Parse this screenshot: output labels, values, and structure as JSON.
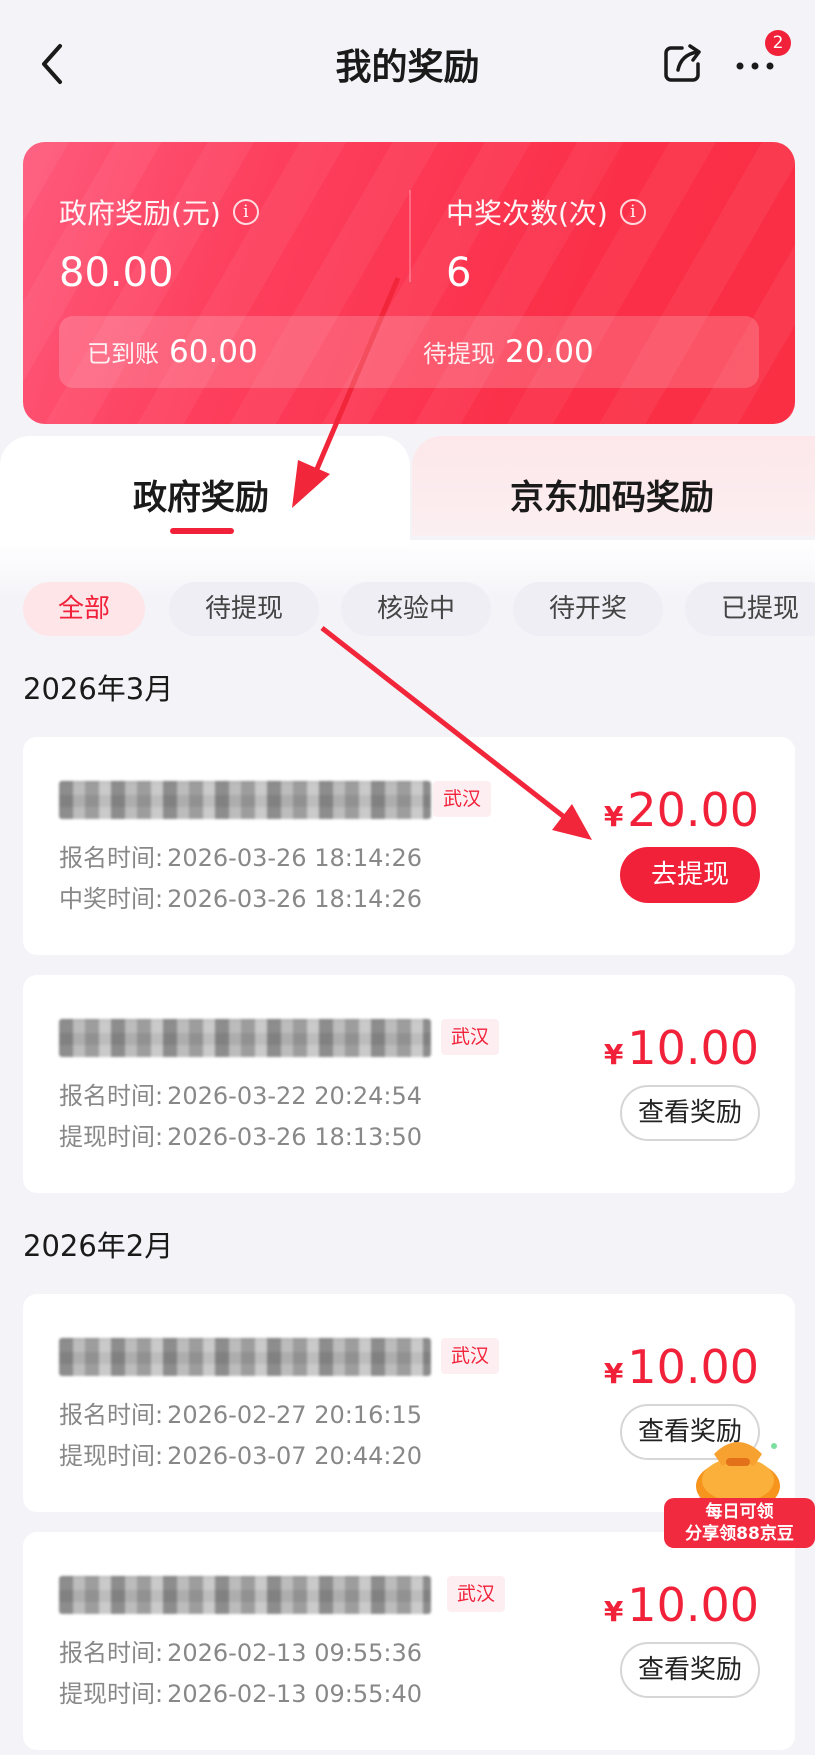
{
  "header": {
    "title": "我的奖励",
    "more_badge": "2",
    "icons": [
      "back-icon",
      "share-icon",
      "more-icon"
    ]
  },
  "summary": {
    "gov_reward_label": "政府奖励(元)",
    "gov_reward_value": "80.00",
    "win_count_label": "中奖次数(次)",
    "win_count_value": "6",
    "credited_label": "已到账",
    "credited_value": "60.00",
    "pending_label": "待提现",
    "pending_value": "20.00",
    "info_glyph": "i"
  },
  "tabs": [
    {
      "label": "政府奖励",
      "active": true
    },
    {
      "label": "京东加码奖励",
      "active": false
    }
  ],
  "filters": [
    {
      "label": "全部",
      "active": true
    },
    {
      "label": "待提现",
      "active": false
    },
    {
      "label": "核验中",
      "active": false
    },
    {
      "label": "待开奖",
      "active": false
    },
    {
      "label": "已提现",
      "active": false
    }
  ],
  "months": [
    {
      "title": "2026年3月",
      "items": [
        {
          "city": "武汉",
          "amount": "20.00",
          "currency": "¥",
          "line1_label": "报名时间:",
          "line1_value": "2026-03-26 18:14:26",
          "line2_label": "中奖时间:",
          "line2_value": "2026-03-26 18:14:26",
          "action": "去提现"
        },
        {
          "city": "武汉",
          "amount": "10.00",
          "currency": "¥",
          "line1_label": "报名时间:",
          "line1_value": "2026-03-22 20:24:54",
          "line2_label": "提现时间:",
          "line2_value": "2026-03-26 18:13:50",
          "action": "查看奖励"
        }
      ]
    },
    {
      "title": "2026年2月",
      "items": [
        {
          "city": "武汉",
          "amount": "10.00",
          "currency": "¥",
          "line1_label": "报名时间:",
          "line1_value": "2026-02-27 20:16:15",
          "line2_label": "提现时间:",
          "line2_value": "2026-03-07 20:44:20",
          "action": "查看奖励"
        },
        {
          "city": "武汉",
          "amount": "10.00",
          "currency": "¥",
          "line1_label": "报名时间:",
          "line1_value": "2026-02-13 09:55:36",
          "line2_label": "提现时间:",
          "line2_value": "2026-02-13 09:55:40",
          "action": "查看奖励"
        }
      ]
    }
  ],
  "promo": {
    "line1": "每日可领",
    "line2": "分享领88京豆"
  },
  "colors": {
    "accent": "#f2213a",
    "card_gradient_start": "#fe5a7c",
    "card_gradient_end": "#fa2f44",
    "page_bg": "#f4f3f8"
  }
}
